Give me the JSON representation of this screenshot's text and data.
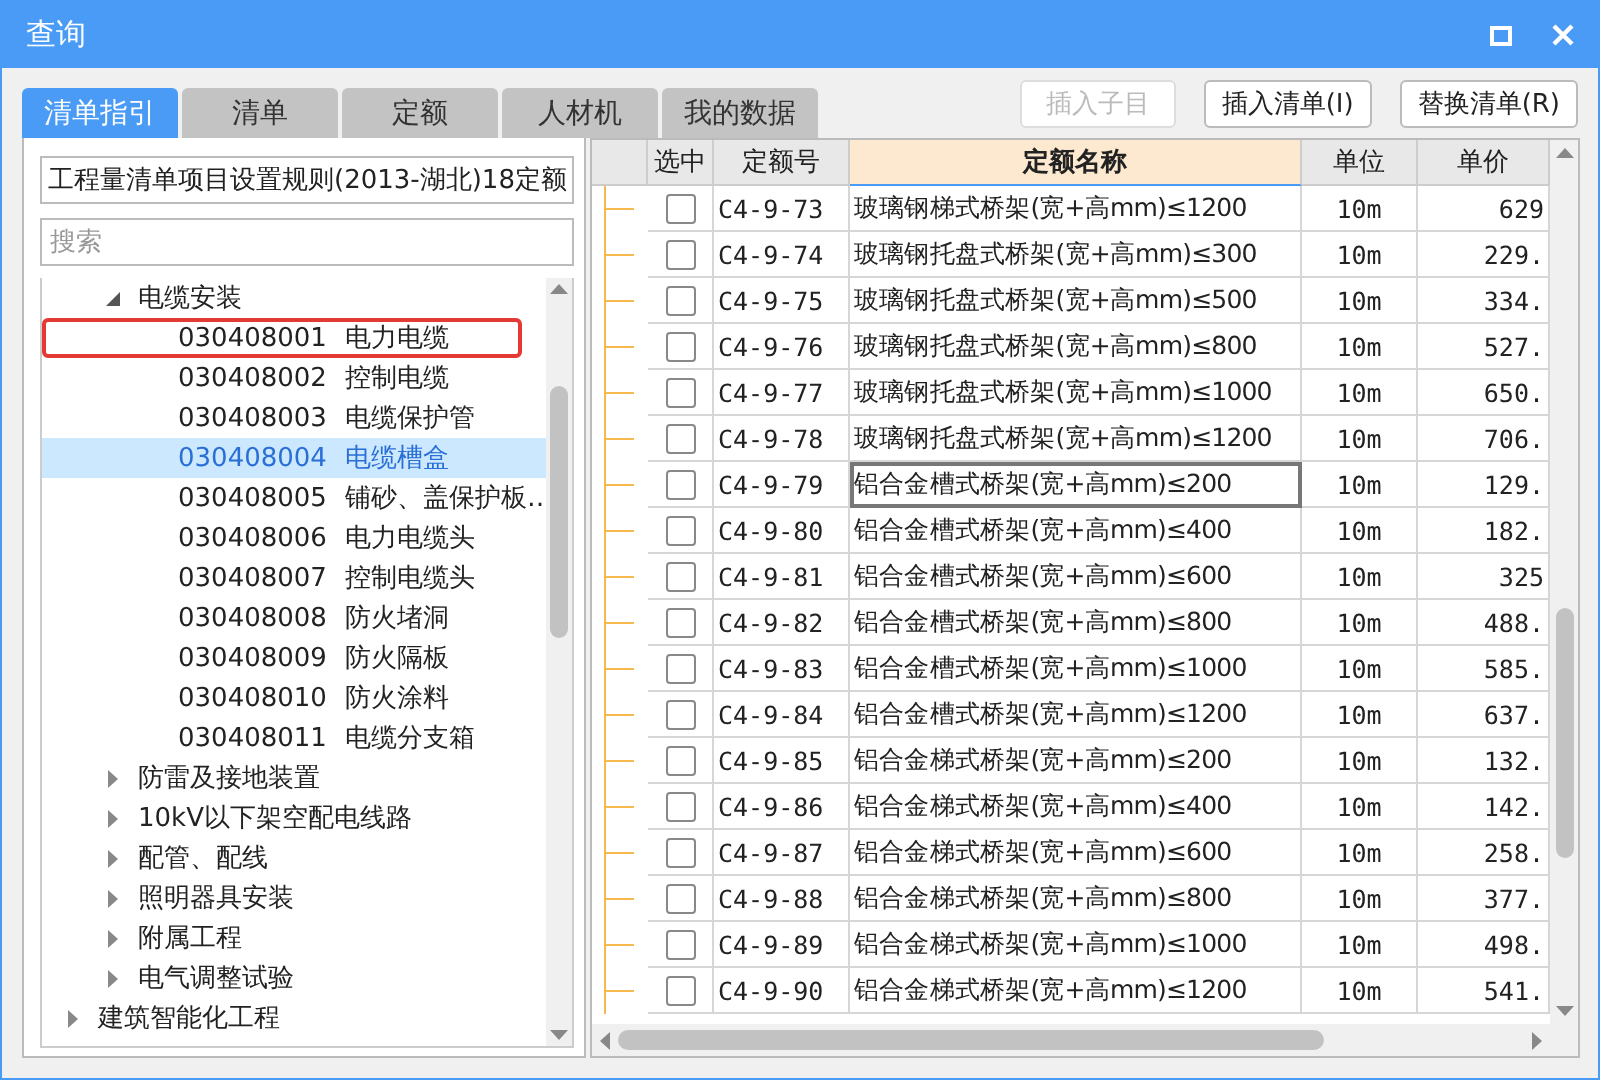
{
  "window": {
    "title": "查询"
  },
  "tabs": [
    {
      "label": "清单指引",
      "selected": true
    },
    {
      "label": "清单",
      "selected": false
    },
    {
      "label": "定额",
      "selected": false
    },
    {
      "label": "人材机",
      "selected": false
    },
    {
      "label": "我的数据",
      "selected": false
    }
  ],
  "buttons": [
    {
      "label": "插入子目",
      "disabled": true
    },
    {
      "label": "插入清单(I)",
      "disabled": false
    },
    {
      "label": "替换清单(R)",
      "disabled": false
    }
  ],
  "rule_select": {
    "value": "工程量清单项目设置规则(2013-湖北)18定额"
  },
  "search": {
    "placeholder": "搜索"
  },
  "tree": [
    {
      "children": [
        {
          "label": "电缆安装",
          "expanded": true,
          "children": [
            {
              "code": "030408001",
              "name": "电力电缆",
              "selected": false,
              "highlighted": true
            },
            {
              "code": "030408002",
              "name": "控制电缆",
              "selected": false,
              "highlighted": false
            },
            {
              "code": "030408003",
              "name": "电缆保护管",
              "selected": false,
              "highlighted": false
            },
            {
              "code": "030408004",
              "name": "电缆槽盒",
              "selected": true,
              "highlighted": false
            },
            {
              "code": "030408005",
              "name": "铺砂、盖保护板…",
              "selected": false,
              "highlighted": false
            },
            {
              "code": "030408006",
              "name": "电力电缆头",
              "selected": false,
              "highlighted": false
            },
            {
              "code": "030408007",
              "name": "控制电缆头",
              "selected": false,
              "highlighted": false
            },
            {
              "code": "030408008",
              "name": "防火堵洞",
              "selected": false,
              "highlighted": false
            },
            {
              "code": "030408009",
              "name": "防火隔板",
              "selected": false,
              "highlighted": false
            },
            {
              "code": "030408010",
              "name": "防火涂料",
              "selected": false,
              "highlighted": false
            },
            {
              "code": "030408011",
              "name": "电缆分支箱",
              "selected": false,
              "highlighted": false
            }
          ]
        },
        {
          "label": "防雷及接地装置",
          "expanded": false
        },
        {
          "label": "10kV以下架空配电线路",
          "expanded": false
        },
        {
          "label": "配管、配线",
          "expanded": false
        },
        {
          "label": "照明器具安装",
          "expanded": false
        },
        {
          "label": "附属工程",
          "expanded": false
        },
        {
          "label": "电气调整试验",
          "expanded": false
        }
      ]
    },
    {
      "label": "建筑智能化工程",
      "expanded": false
    }
  ],
  "table": {
    "columns": [
      {
        "label": "选中",
        "highlighted": false
      },
      {
        "label": "定额号",
        "highlighted": false
      },
      {
        "label": "定额名称",
        "highlighted": true
      },
      {
        "label": "单位",
        "highlighted": false
      },
      {
        "label": "单价",
        "highlighted": false
      }
    ],
    "rows": [
      {
        "checked": false,
        "code": "C4-9-73",
        "name": "玻璃钢梯式桥架(宽+高mm)≤1200",
        "unit": "10m",
        "price": "629",
        "focused": false
      },
      {
        "checked": false,
        "code": "C4-9-74",
        "name": "玻璃钢托盘式桥架(宽+高mm)≤300",
        "unit": "10m",
        "price": "229.",
        "focused": false
      },
      {
        "checked": false,
        "code": "C4-9-75",
        "name": "玻璃钢托盘式桥架(宽+高mm)≤500",
        "unit": "10m",
        "price": "334.",
        "focused": false
      },
      {
        "checked": false,
        "code": "C4-9-76",
        "name": "玻璃钢托盘式桥架(宽+高mm)≤800",
        "unit": "10m",
        "price": "527.",
        "focused": false
      },
      {
        "checked": false,
        "code": "C4-9-77",
        "name": "玻璃钢托盘式桥架(宽+高mm)≤1000",
        "unit": "10m",
        "price": "650.",
        "focused": false
      },
      {
        "checked": false,
        "code": "C4-9-78",
        "name": "玻璃钢托盘式桥架(宽+高mm)≤1200",
        "unit": "10m",
        "price": "706.",
        "focused": false
      },
      {
        "checked": false,
        "code": "C4-9-79",
        "name": "铝合金槽式桥架(宽+高mm)≤200",
        "unit": "10m",
        "price": "129.",
        "focused": true
      },
      {
        "checked": false,
        "code": "C4-9-80",
        "name": "铝合金槽式桥架(宽+高mm)≤400",
        "unit": "10m",
        "price": "182.",
        "focused": false
      },
      {
        "checked": false,
        "code": "C4-9-81",
        "name": "铝合金槽式桥架(宽+高mm)≤600",
        "unit": "10m",
        "price": "325",
        "focused": false
      },
      {
        "checked": false,
        "code": "C4-9-82",
        "name": "铝合金槽式桥架(宽+高mm)≤800",
        "unit": "10m",
        "price": "488.",
        "focused": false
      },
      {
        "checked": false,
        "code": "C4-9-83",
        "name": "铝合金槽式桥架(宽+高mm)≤1000",
        "unit": "10m",
        "price": "585.",
        "focused": false
      },
      {
        "checked": false,
        "code": "C4-9-84",
        "name": "铝合金槽式桥架(宽+高mm)≤1200",
        "unit": "10m",
        "price": "637.",
        "focused": false
      },
      {
        "checked": false,
        "code": "C4-9-85",
        "name": "铝合金梯式桥架(宽+高mm)≤200",
        "unit": "10m",
        "price": "132.",
        "focused": false
      },
      {
        "checked": false,
        "code": "C4-9-86",
        "name": "铝合金梯式桥架(宽+高mm)≤400",
        "unit": "10m",
        "price": "142.",
        "focused": false
      },
      {
        "checked": false,
        "code": "C4-9-87",
        "name": "铝合金梯式桥架(宽+高mm)≤600",
        "unit": "10m",
        "price": "258.",
        "focused": false
      },
      {
        "checked": false,
        "code": "C4-9-88",
        "name": "铝合金梯式桥架(宽+高mm)≤800",
        "unit": "10m",
        "price": "377.",
        "focused": false
      },
      {
        "checked": false,
        "code": "C4-9-89",
        "name": "铝合金梯式桥架(宽+高mm)≤1000",
        "unit": "10m",
        "price": "498.",
        "focused": false
      },
      {
        "checked": false,
        "code": "C4-9-90",
        "name": "铝合金梯式桥架(宽+高mm)≤1200",
        "unit": "10m",
        "price": "541.",
        "focused": false
      }
    ]
  }
}
